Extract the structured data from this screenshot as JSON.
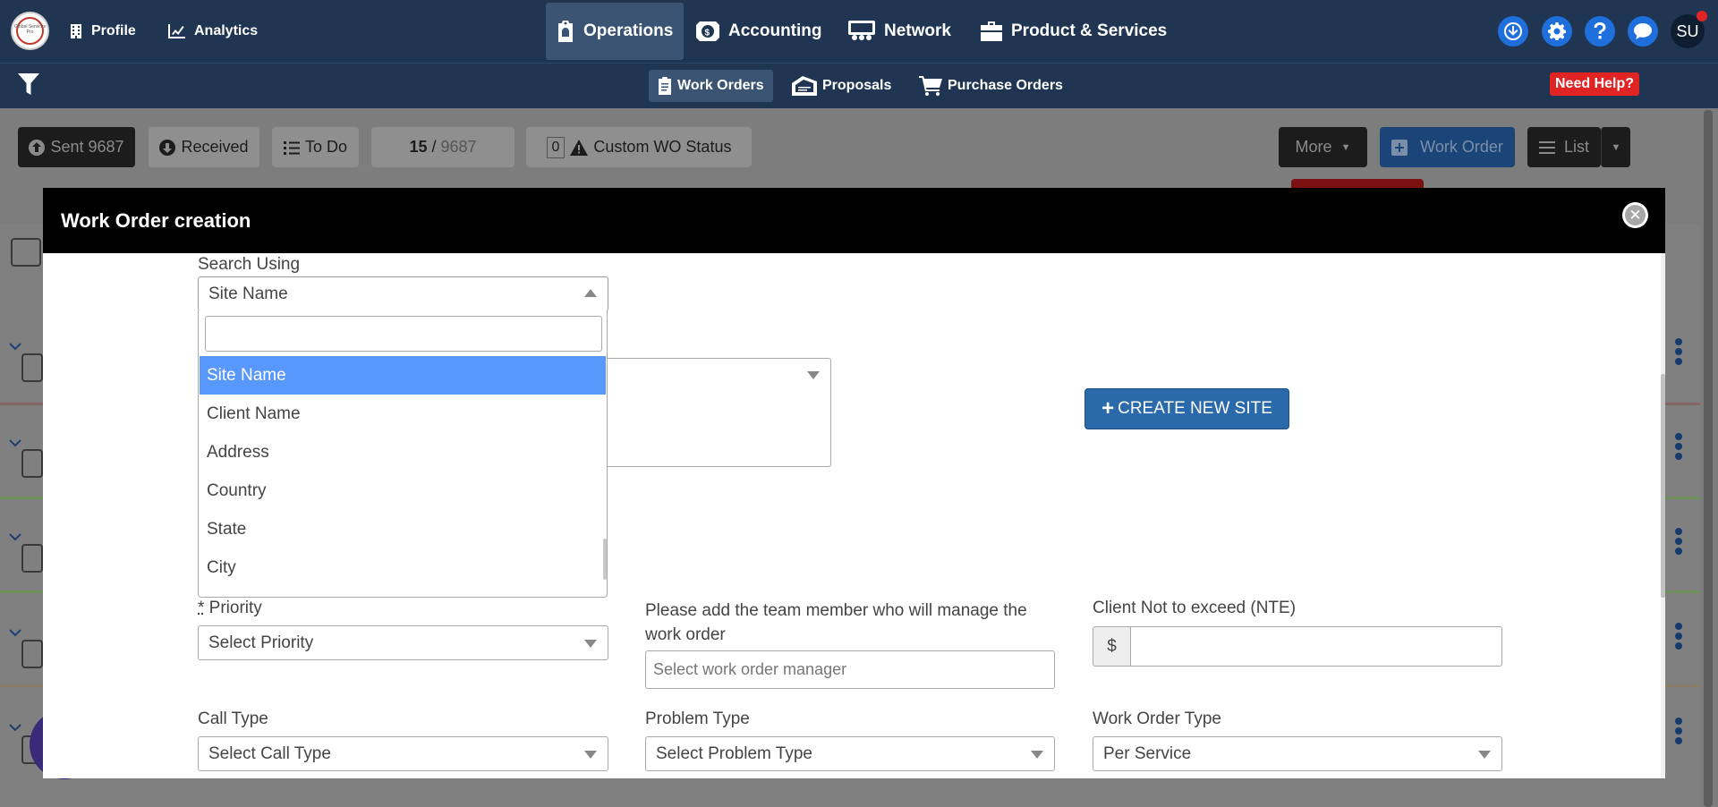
{
  "topnav": {
    "logo_text": "Global Services Pro",
    "profile": "Profile",
    "analytics": "Analytics",
    "operations": "Operations",
    "accounting": "Accounting",
    "network": "Network",
    "products": "Product & Services",
    "avatar": "SU"
  },
  "subnav": {
    "work_orders": "Work Orders",
    "proposals": "Proposals",
    "purchase_orders": "Purchase Orders",
    "need_help": "Need Help?"
  },
  "toolbar": {
    "sent": "Sent 9687",
    "received": "Received",
    "todo": "To Do",
    "page_current": "15",
    "page_sep": " / ",
    "page_total": "9687",
    "custom_count": "0",
    "custom_status": "Custom WO Status",
    "more": "More",
    "work_order": "Work Order",
    "list": "List"
  },
  "modal": {
    "title": "Work Order creation",
    "search_using_label": "Search Using",
    "search_using_value": "Site Name",
    "create_new_site": "CREATE NEW SITE",
    "dropdown_options": [
      "Site Name",
      "Client Name",
      "Address",
      "Country",
      "State",
      "City"
    ],
    "priority_required_mark": "*",
    "priority_label": " Priority",
    "priority_placeholder": "Select Priority",
    "manager_label_line1": "Please add the team member who will manage the",
    "manager_label_line2": "work order",
    "manager_placeholder": "Select work order manager",
    "nte_label": "Client Not to exceed (NTE)",
    "nte_currency": "$",
    "nte_value": "",
    "call_type_label": "Call Type",
    "call_type_placeholder": "Select Call Type",
    "problem_type_label": "Problem Type",
    "problem_type_placeholder": "Select Problem Type",
    "wo_type_label": "Work Order Type",
    "wo_type_value": "Per Service"
  }
}
